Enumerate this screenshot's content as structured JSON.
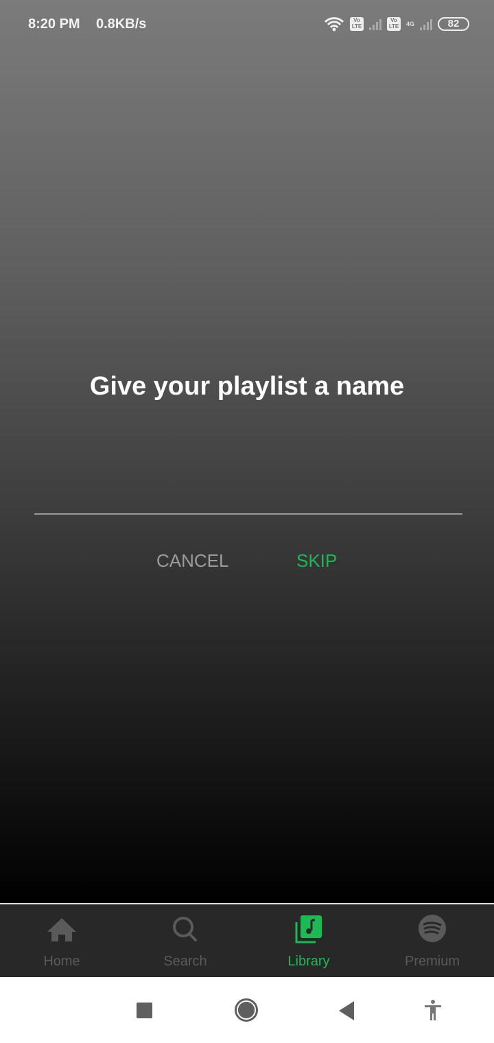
{
  "status_bar": {
    "time": "8:20 PM",
    "net_speed": "0.8KB/s",
    "volte1": "Vo LTE",
    "volte2": "Vo LTE",
    "network": "4G",
    "battery": "82"
  },
  "dialog": {
    "title": "Give your playlist a name",
    "input_value": "",
    "cancel_label": "CANCEL",
    "skip_label": "SKIP",
    "accent": "#1db954"
  },
  "tabs": [
    {
      "label": "Home",
      "icon": "home-icon"
    },
    {
      "label": "Search",
      "icon": "search-icon"
    },
    {
      "label": "Library",
      "icon": "library-icon",
      "active": true
    },
    {
      "label": "Premium",
      "icon": "spotify-icon"
    }
  ],
  "system_nav": [
    "recents-icon",
    "home-circle-icon",
    "back-icon",
    "accessibility-icon"
  ]
}
